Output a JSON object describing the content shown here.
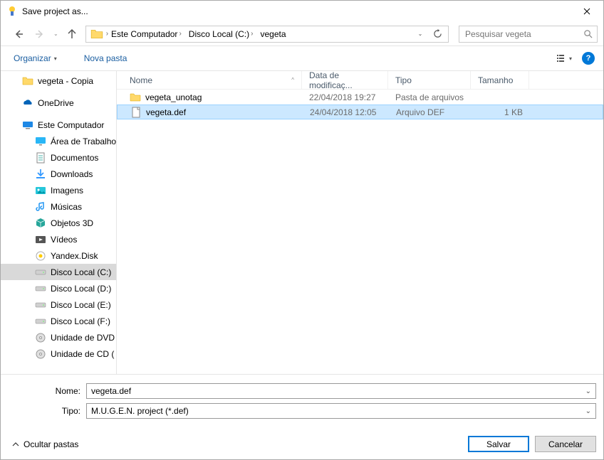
{
  "window": {
    "title": "Save project as..."
  },
  "nav": {
    "breadcrumbs": [
      "Este Computador",
      "Disco Local (C:)",
      "vegeta"
    ],
    "search_placeholder": "Pesquisar vegeta"
  },
  "toolbar": {
    "organize": "Organizar",
    "new_folder": "Nova pasta"
  },
  "tree": {
    "items": [
      {
        "label": "vegeta - Copia",
        "icon": "folder",
        "lvl": 1
      },
      {
        "spacer": true
      },
      {
        "label": "OneDrive",
        "icon": "onedrive",
        "lvl": 1
      },
      {
        "spacer": true
      },
      {
        "label": "Este Computador",
        "icon": "pc",
        "lvl": 1
      },
      {
        "label": "Área de Trabalho",
        "icon": "desktop",
        "lvl": 2
      },
      {
        "label": "Documentos",
        "icon": "docs",
        "lvl": 2
      },
      {
        "label": "Downloads",
        "icon": "downloads",
        "lvl": 2
      },
      {
        "label": "Imagens",
        "icon": "images",
        "lvl": 2
      },
      {
        "label": "Músicas",
        "icon": "music",
        "lvl": 2
      },
      {
        "label": "Objetos 3D",
        "icon": "3d",
        "lvl": 2
      },
      {
        "label": "Vídeos",
        "icon": "videos",
        "lvl": 2
      },
      {
        "label": "Yandex.Disk",
        "icon": "yandex",
        "lvl": 2
      },
      {
        "label": "Disco Local (C:)",
        "icon": "disk",
        "lvl": 2,
        "selected": true
      },
      {
        "label": "Disco Local (D:)",
        "icon": "disk",
        "lvl": 2
      },
      {
        "label": "Disco Local (E:)",
        "icon": "disk",
        "lvl": 2
      },
      {
        "label": "Disco Local (F:)",
        "icon": "disk",
        "lvl": 2
      },
      {
        "label": "Unidade de DVD (",
        "icon": "dvd",
        "lvl": 2
      },
      {
        "label": "Unidade de CD (",
        "icon": "cd",
        "lvl": 2
      }
    ]
  },
  "columns": {
    "name": "Nome",
    "modified": "Data de modificaç...",
    "type": "Tipo",
    "size": "Tamanho"
  },
  "files": [
    {
      "name": "vegeta_unotag",
      "date": "22/04/2018 19:27",
      "type": "Pasta de arquivos",
      "size": "",
      "icon": "folder",
      "selected": false
    },
    {
      "name": "vegeta.def",
      "date": "24/04/2018 12:05",
      "type": "Arquivo DEF",
      "size": "1 KB",
      "icon": "file",
      "selected": true
    }
  ],
  "form": {
    "name_label": "Nome:",
    "name_value": "vegeta.def",
    "type_label": "Tipo:",
    "type_value": "M.U.G.E.N. project (*.def)"
  },
  "footer": {
    "hide_folders": "Ocultar pastas",
    "save": "Salvar",
    "cancel": "Cancelar"
  }
}
